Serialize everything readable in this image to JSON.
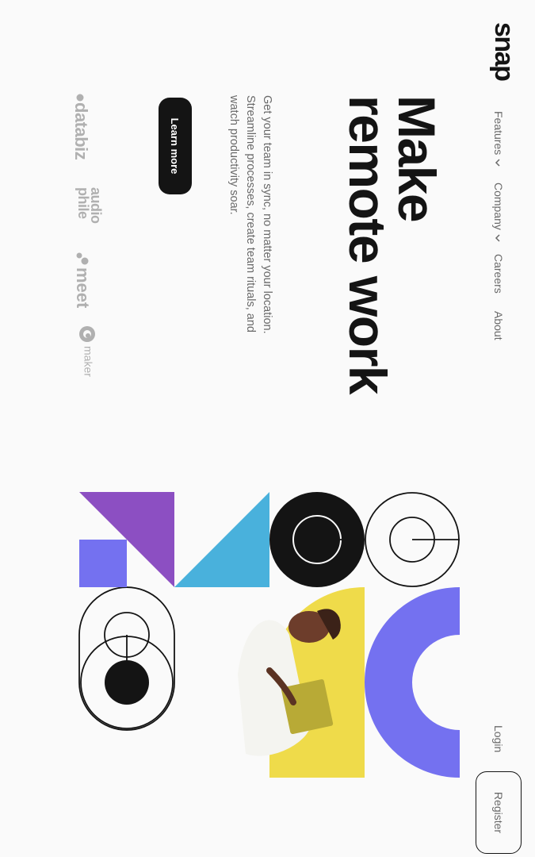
{
  "brand": {
    "logo": "snap"
  },
  "nav": {
    "items": [
      {
        "label": "Features",
        "has_dropdown": true
      },
      {
        "label": "Company",
        "has_dropdown": true
      },
      {
        "label": "Careers",
        "has_dropdown": false
      },
      {
        "label": "About",
        "has_dropdown": false
      }
    ]
  },
  "auth": {
    "login_label": "Login",
    "register_label": "Register"
  },
  "hero": {
    "headline_line1": "Make",
    "headline_line2": "remote work",
    "description": "Get your team in sync, no matter your location. Streamline processes, create team rituals, and watch productivity soar.",
    "cta_label": "Learn more"
  },
  "clients": {
    "databiz": "databiz",
    "audiophile_top": "audio",
    "audiophile_bottom": "phile",
    "meet": "meet",
    "maker": "maker"
  },
  "colors": {
    "purple": "#8c4fc2",
    "violet": "#7471f0",
    "yellow": "#efdb4a",
    "sky": "#49b1dc",
    "ink": "#141414",
    "muted_text": "#696969",
    "logo_gray": "#b0b0b0",
    "background": "#fafafa"
  }
}
